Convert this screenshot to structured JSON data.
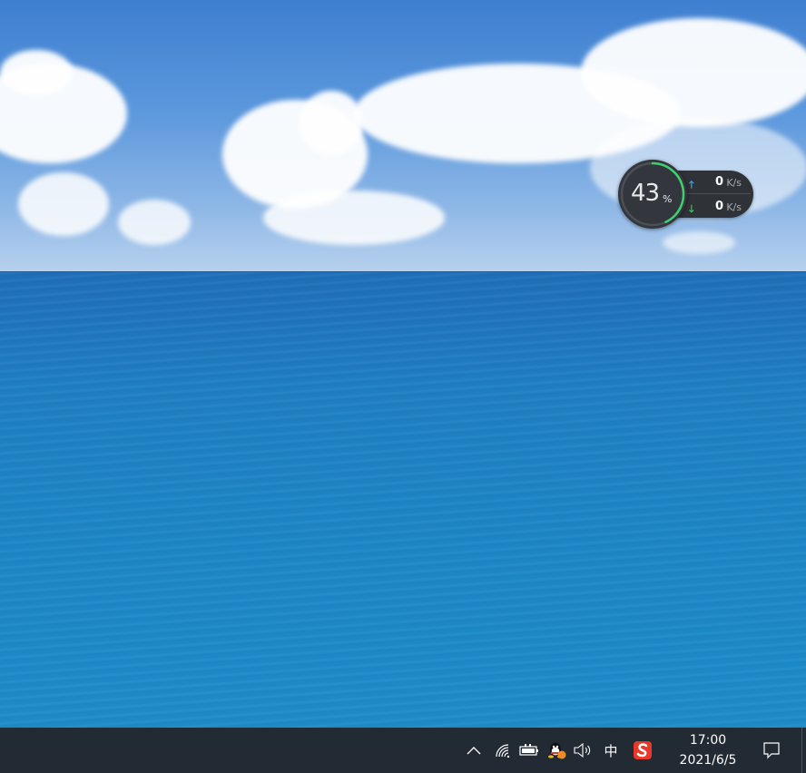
{
  "widget": {
    "memory_value": "43",
    "memory_unit": "%",
    "memory_percent": 43,
    "upload": {
      "value": "0",
      "unit": "K/s",
      "icon": "upload-arrow-icon"
    },
    "download": {
      "value": "0",
      "unit": "K/s",
      "icon": "download-arrow-icon"
    },
    "colors": {
      "ring": "#3ecf6e",
      "ring_track": "#4b4f56",
      "upload_arrow": "#3fa7e6",
      "download_arrow": "#3fcf5a",
      "background": "#2f3237"
    }
  },
  "taskbar": {
    "color": "#222a33",
    "tray_icons": [
      "chevron-up-icon",
      "wifi-icon",
      "battery-icon",
      "qq-icon",
      "volume-icon",
      "ime-icon",
      "sogou-icon"
    ],
    "ime_label": "中",
    "clock": {
      "time": "17:00",
      "date": "2021/6/5"
    },
    "action_center_icon": "notification-icon"
  }
}
